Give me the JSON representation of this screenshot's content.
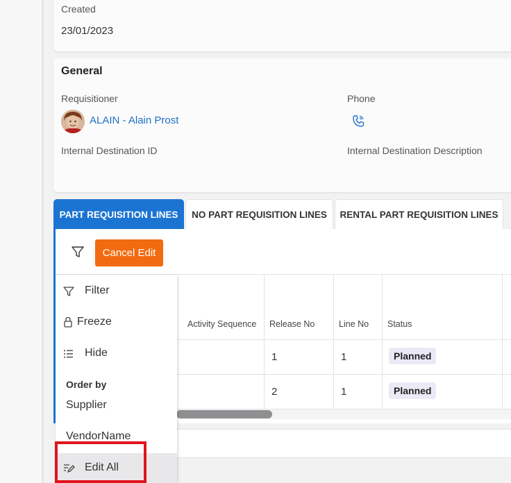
{
  "created": {
    "label": "Created",
    "value": "23/01/2023"
  },
  "general": {
    "title": "General",
    "requisitioner_label": "Requisitioner",
    "requisitioner_value": "ALAIN - Alain Prost",
    "phone_label": "Phone",
    "internal_dest_id_label": "Internal Destination ID",
    "internal_dest_desc_label": "Internal Destination Description"
  },
  "tabs": [
    {
      "label": "PART REQUISITION LINES",
      "active": true
    },
    {
      "label": "NO PART REQUISITION LINES",
      "active": false
    },
    {
      "label": "RENTAL PART REQUISITION LINES",
      "active": false
    }
  ],
  "toolbar": {
    "cancel_edit_label": "Cancel Edit"
  },
  "table": {
    "columns": [
      "Activity Sequence",
      "Release No",
      "Line No",
      "Status"
    ],
    "rows": [
      {
        "activity_sequence": "",
        "release_no": "1",
        "line_no": "1",
        "status": "Planned"
      },
      {
        "activity_sequence": "",
        "release_no": "2",
        "line_no": "1",
        "status": "Planned"
      }
    ]
  },
  "context_menu": {
    "filter": "Filter",
    "freeze": "Freeze",
    "hide": "Hide",
    "order_by": "Order by",
    "supplier": "Supplier",
    "vendor_name": "VendorName",
    "edit_all": "Edit All"
  },
  "colors": {
    "accent": "#1b74d2",
    "cancel": "#f26b10",
    "highlight_box": "#e0141c",
    "link": "#1f6fc4"
  },
  "icons": [
    "phone-icon",
    "filter-funnel-icon",
    "lock-icon",
    "list-icon",
    "edit-lines-icon"
  ]
}
